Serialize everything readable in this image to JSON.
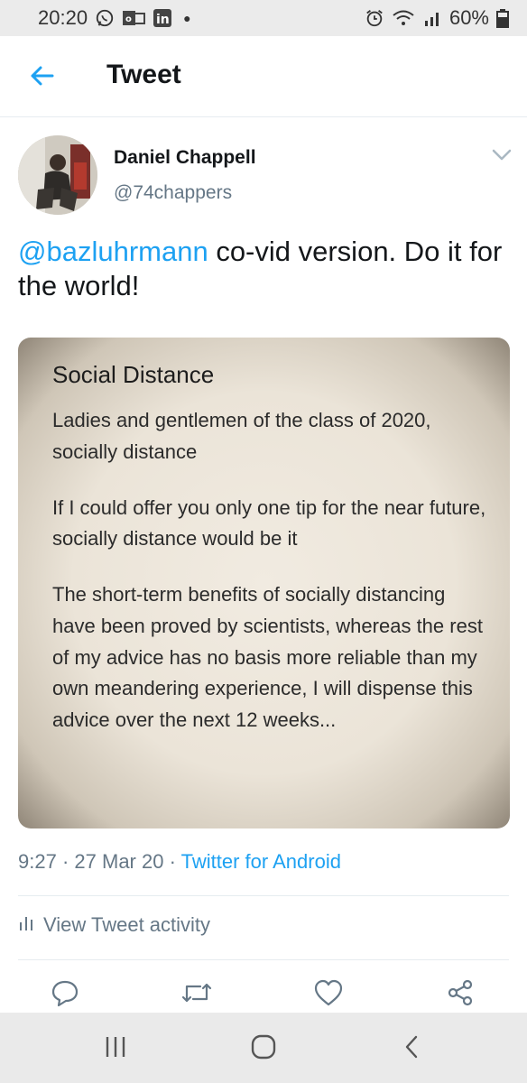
{
  "status_bar": {
    "time": "20:20",
    "battery": "60%",
    "icons": [
      "whatsapp-icon",
      "outlook-icon",
      "linkedin-icon",
      "dot-icon",
      "alarm-icon",
      "wifi-icon",
      "signal-icon",
      "battery-icon"
    ]
  },
  "header": {
    "title": "Tweet",
    "back_icon": "arrow-left-icon"
  },
  "tweet": {
    "author_name": "Daniel Chappell",
    "author_handle": "@74chappers",
    "mention": "@bazluhrmann",
    "text_rest": " co-vid version. Do it for the world!",
    "media": {
      "title": "Social Distance",
      "paragraphs": [
        "Ladies and gentlemen of the class of 2020, socially distance",
        "If I could offer you only one tip for the near future, socially distance would be it",
        "The short-term benefits of socially distancing have been proved by scientists, whereas the rest of my advice has no basis more reliable than my own meandering experience, I will dispense this advice over the next 12 weeks..."
      ]
    },
    "time": "9:27",
    "date": "27 Mar 20",
    "source": "Twitter for Android",
    "separator": "·",
    "activity_label": "View Tweet activity"
  },
  "actions": [
    "reply-icon",
    "retweet-icon",
    "like-icon",
    "share-icon"
  ],
  "nav": [
    "recents-icon",
    "home-icon",
    "back-icon"
  ],
  "colors": {
    "accent": "#1da1f2",
    "secondary_text": "#657786",
    "primary_text": "#14171a",
    "status_bar_bg": "#ebebeb"
  }
}
